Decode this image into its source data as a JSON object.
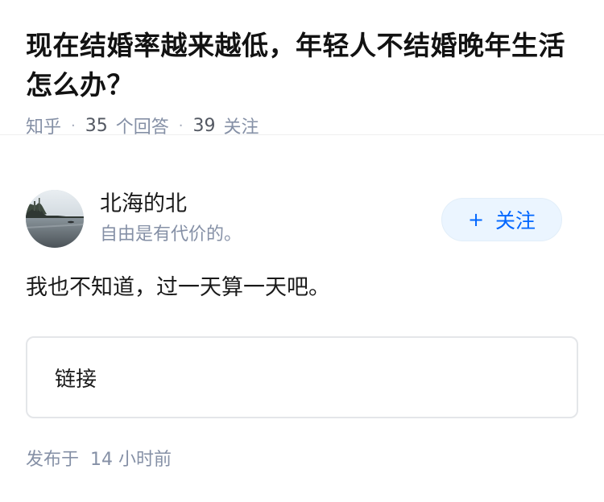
{
  "question": {
    "title": "现在结婚率越来越低，年轻人不结婚晚年生活怎么办？",
    "source": "知乎",
    "answer_count": "35",
    "answer_label": "个回答",
    "follow_count": "39",
    "follow_label": "关注"
  },
  "author": {
    "name": "北海的北",
    "bio": "自由是有代价的。",
    "avatar_icon": "lake-landscape-avatar",
    "follow_button": "+ 关注",
    "follow_plus": "+",
    "follow_text": "关注"
  },
  "answer": {
    "text": "我也不知道，过一天算一天吧。",
    "link_label": "链接"
  },
  "footer": {
    "published_prefix": "发布于",
    "published_time": "14 小时前"
  },
  "colors": {
    "accent": "#0066ff",
    "accent_bg": "#ebf5ff",
    "muted": "#8590a6",
    "text": "#1a1a1a"
  }
}
